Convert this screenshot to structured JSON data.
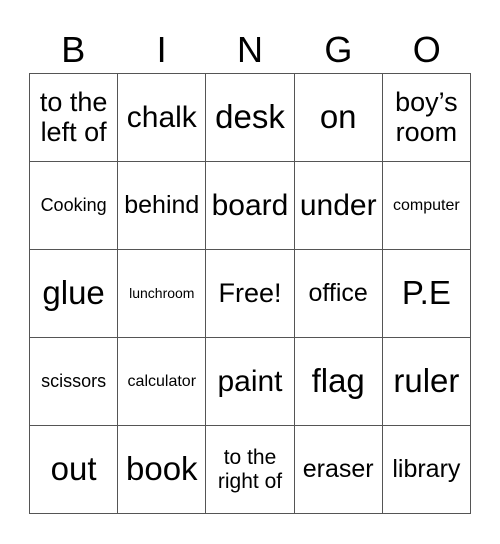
{
  "header": {
    "letters": [
      "B",
      "I",
      "N",
      "G",
      "O"
    ]
  },
  "card": {
    "rows": [
      [
        "to the left of",
        "chalk",
        "desk",
        "on",
        "boy’s room"
      ],
      [
        "Cooking",
        "behind",
        "board",
        "under",
        "computer"
      ],
      [
        "glue",
        "lunchroom",
        "Free!",
        "office",
        "P.E"
      ],
      [
        "scissors",
        "calculator",
        "paint",
        "flag",
        "ruler"
      ],
      [
        "out",
        "book",
        "to the right of",
        "eraser",
        "library"
      ]
    ]
  }
}
